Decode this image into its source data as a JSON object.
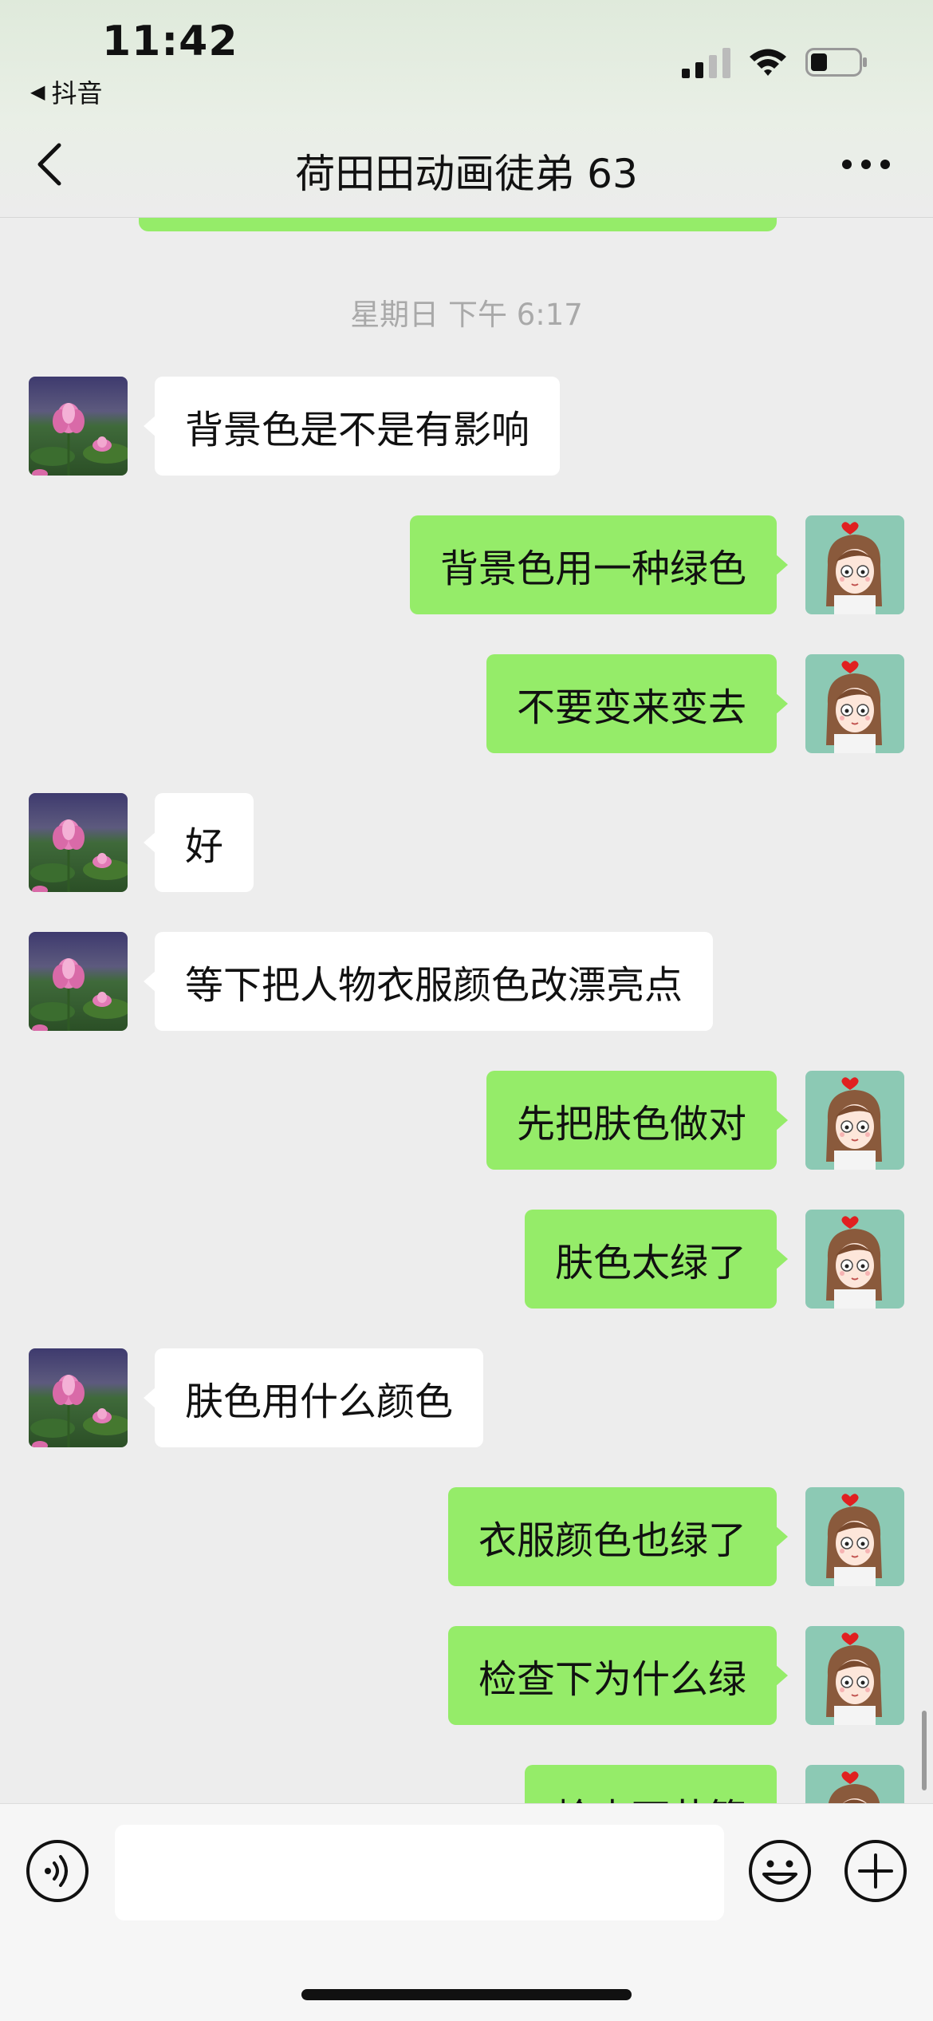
{
  "status_bar": {
    "time": "11:42",
    "back_app_label": "抖音"
  },
  "nav": {
    "title": "荷田田动画徒弟 63"
  },
  "chat": {
    "timestamp": "星期日 下午 6:17",
    "messages": [
      {
        "side": "left",
        "text": "背景色是不是有影响"
      },
      {
        "side": "right",
        "text": "背景色用一种绿色"
      },
      {
        "side": "right",
        "text": "不要变来变去"
      },
      {
        "side": "left",
        "text": "好"
      },
      {
        "side": "left",
        "text": "等下把人物衣服颜色改漂亮点"
      },
      {
        "side": "right",
        "text": "先把肤色做对"
      },
      {
        "side": "right",
        "text": "肤色太绿了"
      },
      {
        "side": "left",
        "text": "肤色用什么颜色"
      },
      {
        "side": "right",
        "text": "衣服颜色也绿了"
      },
      {
        "side": "right",
        "text": "检查下为什么绿"
      },
      {
        "side": "right",
        "text": "检查下节篇"
      }
    ]
  },
  "input": {
    "placeholder": ""
  },
  "colors": {
    "sent_bubble": "#95ec69",
    "received_bubble": "#ffffff",
    "background": "#ededed"
  },
  "icons": {
    "back": "chevron-left-icon",
    "more": "more-dots-icon",
    "voice": "voice-icon",
    "emoji": "emoji-icon",
    "plus": "plus-icon"
  }
}
